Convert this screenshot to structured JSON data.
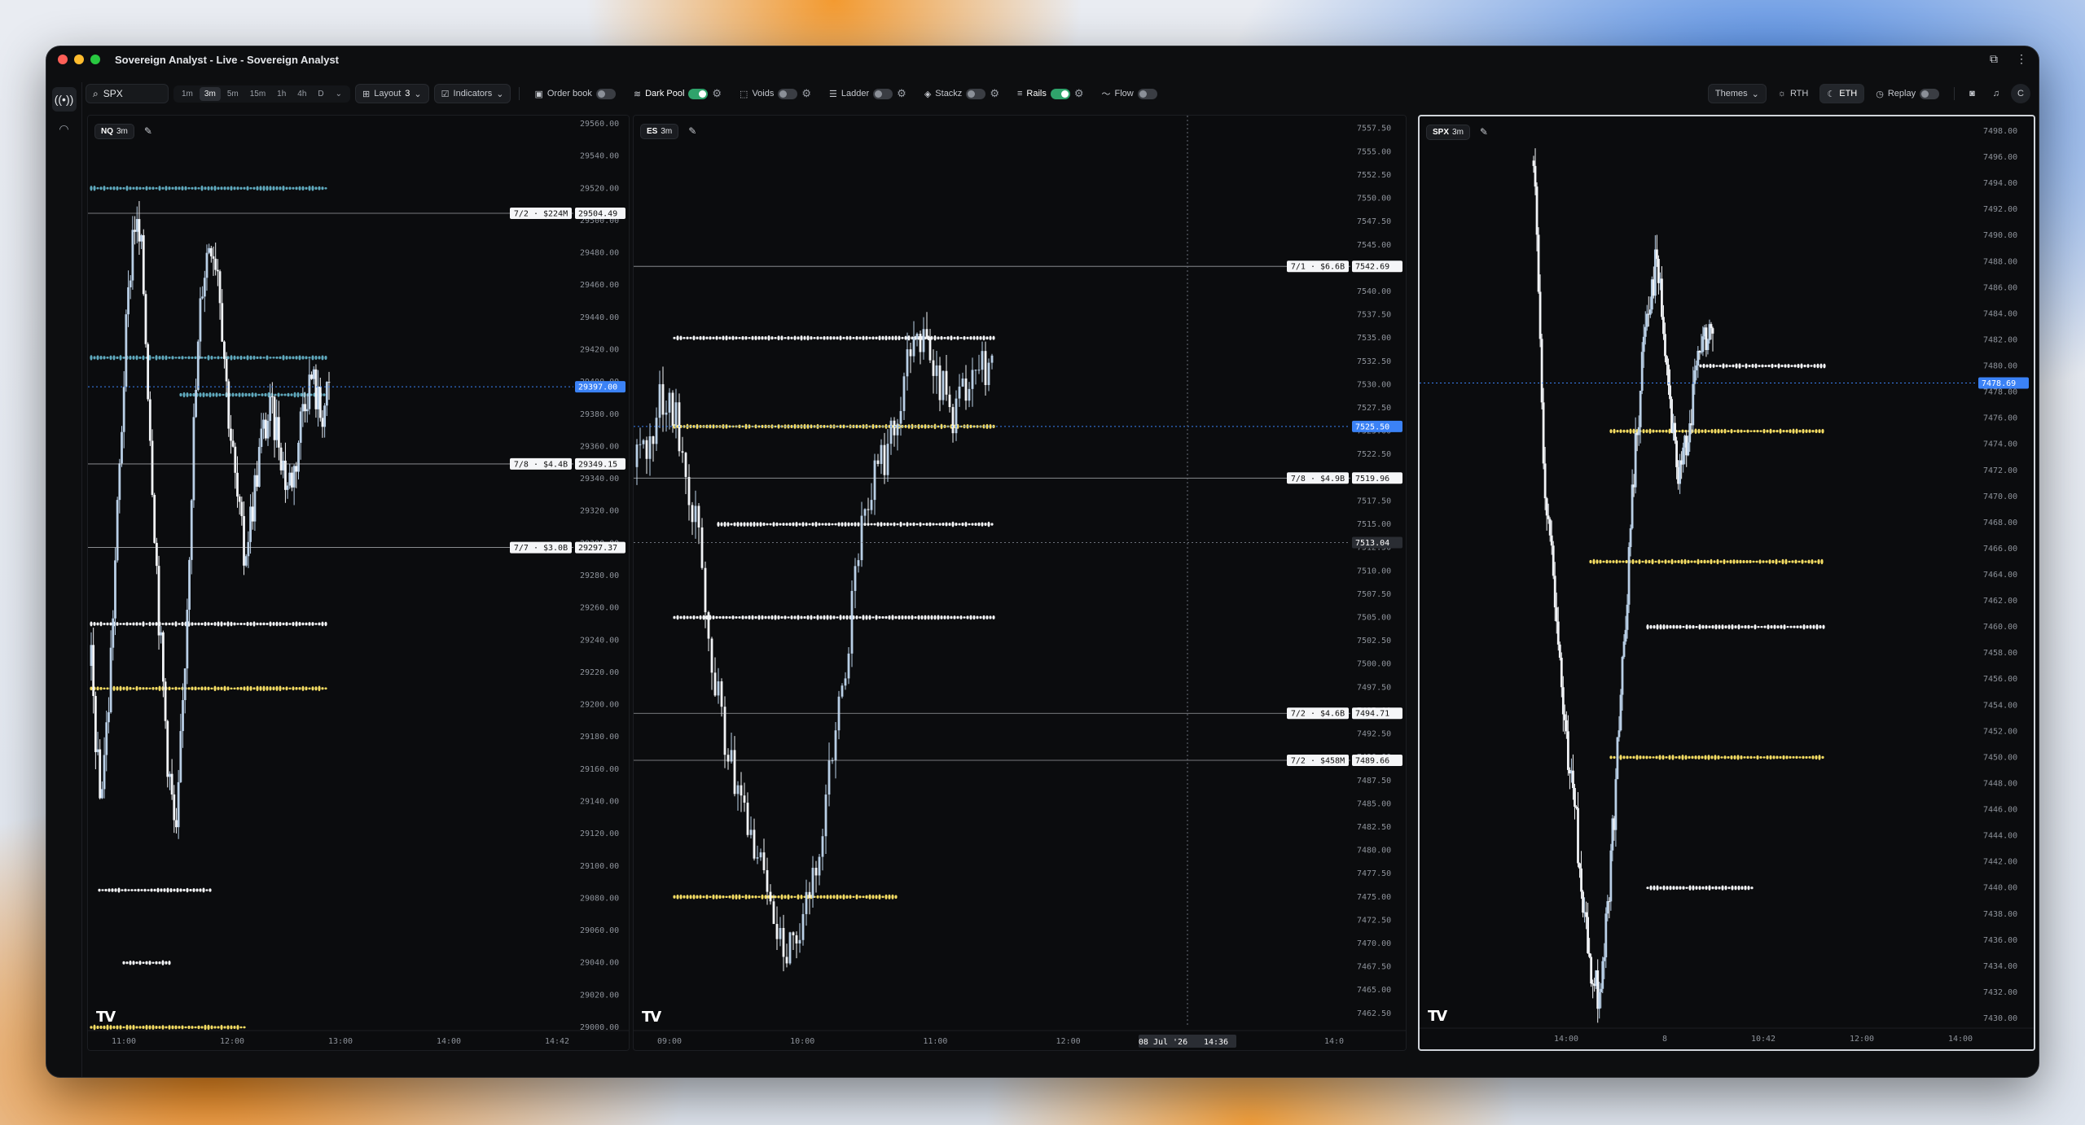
{
  "app": {
    "title": "Sovereign Analyst - Live - Sovereign Analyst",
    "traffic_colors": [
      "#ff5f57",
      "#febc2e",
      "#28c840"
    ]
  },
  "toolbar": {
    "search_value": "SPX",
    "timeframes": [
      "1m",
      "3m",
      "5m",
      "15m",
      "1h",
      "4h",
      "D"
    ],
    "active_timeframe": "3m",
    "layout_label": "Layout",
    "layout_count": "3",
    "indicators_label": "Indicators",
    "order_book_label": "Order book",
    "dark_pool_label": "Dark Pool",
    "voids_label": "Voids",
    "ladder_label": "Ladder",
    "stackz_label": "Stackz",
    "rails_label": "Rails",
    "flow_label": "Flow",
    "themes_label": "Themes",
    "rth_label": "RTH",
    "eth_label": "ETH",
    "replay_label": "Replay",
    "avatar_letter": "C"
  },
  "panes": [
    {
      "symbol": "NQ",
      "timeframe": "3m",
      "price_ticks": [
        "29560.00",
        "29540.00",
        "29520.00",
        "29500.00",
        "29480.00",
        "29460.00",
        "29440.00",
        "29420.00",
        "29400.00",
        "29380.00",
        "29360.00",
        "29340.00",
        "29320.00",
        "29300.00",
        "29280.00",
        "29260.00",
        "29240.00",
        "29220.00",
        "29200.00",
        "29180.00",
        "29160.00",
        "29140.00",
        "29120.00",
        "29100.00",
        "29080.00",
        "29060.00",
        "29040.00",
        "29020.00",
        "29000.00"
      ],
      "y_range": [
        29000,
        29560
      ],
      "time_ticks": [
        "11:00",
        "12:00",
        "13:00",
        "14:00",
        "14:42"
      ],
      "last_price": "29397.00",
      "levels": [
        {
          "label": "7/2 · $224M",
          "price": "29504.49"
        },
        {
          "label": "7/8 · $4.4B",
          "price": "29349.15"
        },
        {
          "label": "7/7 · $3.0B",
          "price": "29297.37"
        }
      ]
    },
    {
      "symbol": "ES",
      "timeframe": "3m",
      "price_ticks": [
        "7557.50",
        "7555.00",
        "7552.50",
        "7550.00",
        "7547.50",
        "7545.00",
        "7542.50",
        "7540.00",
        "7537.50",
        "7535.00",
        "7532.50",
        "7530.00",
        "7527.50",
        "7525.00",
        "7522.50",
        "7520.00",
        "7517.50",
        "7515.00",
        "7512.50",
        "7510.00",
        "7507.50",
        "7505.00",
        "7502.50",
        "7500.00",
        "7497.50",
        "7495.00",
        "7492.50",
        "7490.00",
        "7487.50",
        "7485.00",
        "7482.50",
        "7480.00",
        "7477.50",
        "7475.00",
        "7472.50",
        "7470.00",
        "7467.50",
        "7465.00",
        "7462.50"
      ],
      "y_range": [
        7461,
        7558
      ],
      "time_ticks": [
        "09:00",
        "10:00",
        "11:00",
        "12:00",
        "13:00",
        "14:0"
      ],
      "crosshair_time": "08 Jul '26",
      "crosshair_clock": "14:36",
      "last_price": "7525.50",
      "crosshair_price": "7513.04",
      "levels": [
        {
          "label": "7/1 · $6.6B",
          "price": "7542.69"
        },
        {
          "label": "7/8 · $4.9B",
          "price": "7519.96"
        },
        {
          "label": "7/2 · $4.6B",
          "price": "7494.71"
        },
        {
          "label": "7/2 · $458M",
          "price": "7489.66"
        }
      ]
    },
    {
      "symbol": "SPX",
      "timeframe": "3m",
      "price_ticks": [
        "7498.00",
        "7496.00",
        "7494.00",
        "7492.00",
        "7490.00",
        "7488.00",
        "7486.00",
        "7484.00",
        "7482.00",
        "7480.00",
        "7478.00",
        "7476.00",
        "7474.00",
        "7472.00",
        "7470.00",
        "7468.00",
        "7466.00",
        "7464.00",
        "7462.00",
        "7460.00",
        "7458.00",
        "7456.00",
        "7454.00",
        "7452.00",
        "7450.00",
        "7448.00",
        "7446.00",
        "7444.00",
        "7442.00",
        "7440.00",
        "7438.00",
        "7436.00",
        "7434.00",
        "7432.00",
        "7430.00"
      ],
      "y_range": [
        7429.5,
        7498.5
      ],
      "time_ticks": [
        "14:00",
        "8",
        "10:42",
        "12:00",
        "14:00"
      ],
      "last_price": "7478.69",
      "levels": []
    }
  ],
  "colors": {
    "accent_blue": "#3b82f6",
    "candle_up": "#b9cfe6",
    "candle_down": "#f2f4f7",
    "dots_yellow": "#f4dc63",
    "dots_teal": "#5fa9bd",
    "toggle_on": "#2fa36b"
  }
}
